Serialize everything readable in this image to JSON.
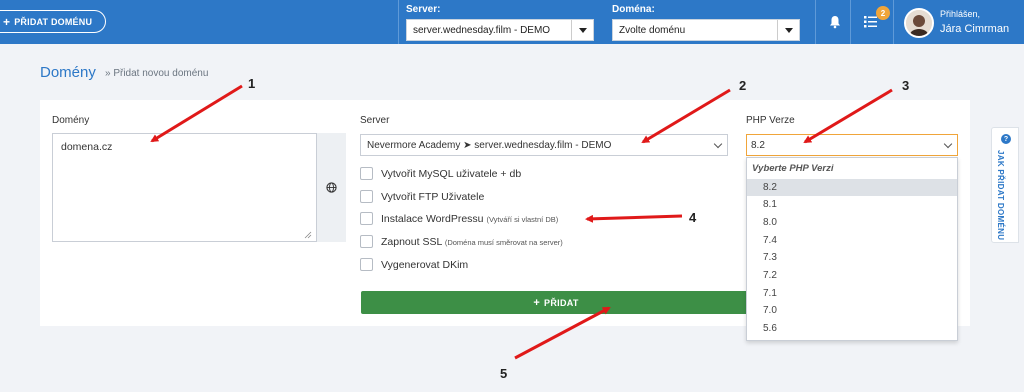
{
  "header": {
    "add_domain_label": "PŘIDAT DOMÉNU",
    "server_label": "Server:",
    "server_value": "server.wednesday.film - DEMO",
    "domain_label": "Doména:",
    "domain_value": "Zvolte doménu",
    "notifications_count": "2",
    "user_greeting": "Přihlášen,",
    "user_name": "Jára Cimrman"
  },
  "page": {
    "title": "Domény",
    "breadcrumb": "» Přidat novou doménu"
  },
  "form": {
    "domains_label": "Domény",
    "domains_value": "domena.cz",
    "server_label": "Server",
    "server_value": "Nevermore Academy ➤ server.wednesday.film - DEMO",
    "php_label": "PHP Verze",
    "php_value": "8.2",
    "checkboxes": [
      {
        "label": "Vytvořit MySQL uživatele + db",
        "note": ""
      },
      {
        "label": "Vytvořit FTP Uživatele",
        "note": ""
      },
      {
        "label": "Instalace WordPressu",
        "note": "(Vytváří si vlastní DB)"
      },
      {
        "label": "Zapnout SSL",
        "note": "(Doména musí směrovat na server)"
      },
      {
        "label": "Vygenerovat DKim",
        "note": ""
      }
    ],
    "submit_label": "PŘIDAT"
  },
  "php_dropdown": {
    "header": "Vyberte PHP Verzi",
    "options": [
      "8.2",
      "8.1",
      "8.0",
      "7.4",
      "7.3",
      "7.2",
      "7.1",
      "7.0",
      "5.6"
    ],
    "selected": "8.2"
  },
  "side_tab": {
    "label": "JAK PŘIDAT DOMÉNU"
  },
  "annotations": [
    "1",
    "2",
    "3",
    "4",
    "5"
  ],
  "colors": {
    "header_bg": "#2d78c7",
    "submit_bg": "#3d8f46",
    "badge": "#f0a53a",
    "arrow": "#e01919"
  }
}
